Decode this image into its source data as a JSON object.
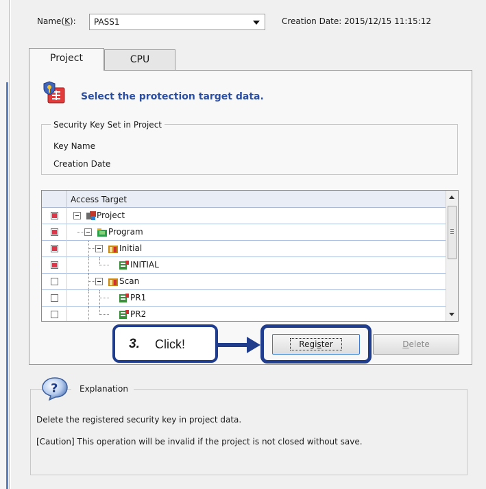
{
  "header": {
    "name_label_prefix": "Name(",
    "name_label_key": "K",
    "name_label_suffix": "):",
    "name_value": "PASS1",
    "creation_date": "Creation Date: 2015/12/15 11:15:12"
  },
  "tabs": [
    {
      "label": "Project",
      "selected": true
    },
    {
      "label": "CPU",
      "selected": false
    }
  ],
  "protection": {
    "title": "Select the protection target data."
  },
  "security_key_group": {
    "legend": "Security Key Set in Project",
    "key_name_label": "Key Name",
    "creation_date_label": "Creation Date"
  },
  "tree": {
    "header": "Access Target",
    "rows": [
      {
        "label": "Project",
        "checked": true,
        "icon": "project-icon",
        "level": 0,
        "expandable": true
      },
      {
        "label": "Program",
        "checked": true,
        "icon": "program-folder-icon",
        "level": 1,
        "expandable": true
      },
      {
        "label": "Initial",
        "checked": true,
        "icon": "program-type-icon",
        "level": 2,
        "expandable": true
      },
      {
        "label": "INITIAL",
        "checked": true,
        "icon": "program-file-icon",
        "level": 3,
        "expandable": false
      },
      {
        "label": "Scan",
        "checked": false,
        "icon": "program-type-icon",
        "level": 2,
        "expandable": true
      },
      {
        "label": "PR1",
        "checked": false,
        "icon": "program-file-icon",
        "level": 3,
        "expandable": false
      },
      {
        "label": "PR2",
        "checked": false,
        "icon": "program-file-icon",
        "level": 3,
        "expandable": false
      }
    ]
  },
  "buttons": {
    "register_pre": "Regi",
    "register_key": "s",
    "register_post": "ter",
    "delete_key": "D",
    "delete_post": "elete"
  },
  "callout": {
    "step": "3.",
    "text": "Click!"
  },
  "explanation": {
    "legend": "Explanation",
    "line1": "Delete the registered security key in project data.",
    "line2": "[Caution] This operation will be invalid if the project is not closed without save."
  },
  "colors": {
    "callout_border": "#1f3d8c",
    "title_blue": "#2b4ea5",
    "checkbox_checked": "#d9374a"
  }
}
